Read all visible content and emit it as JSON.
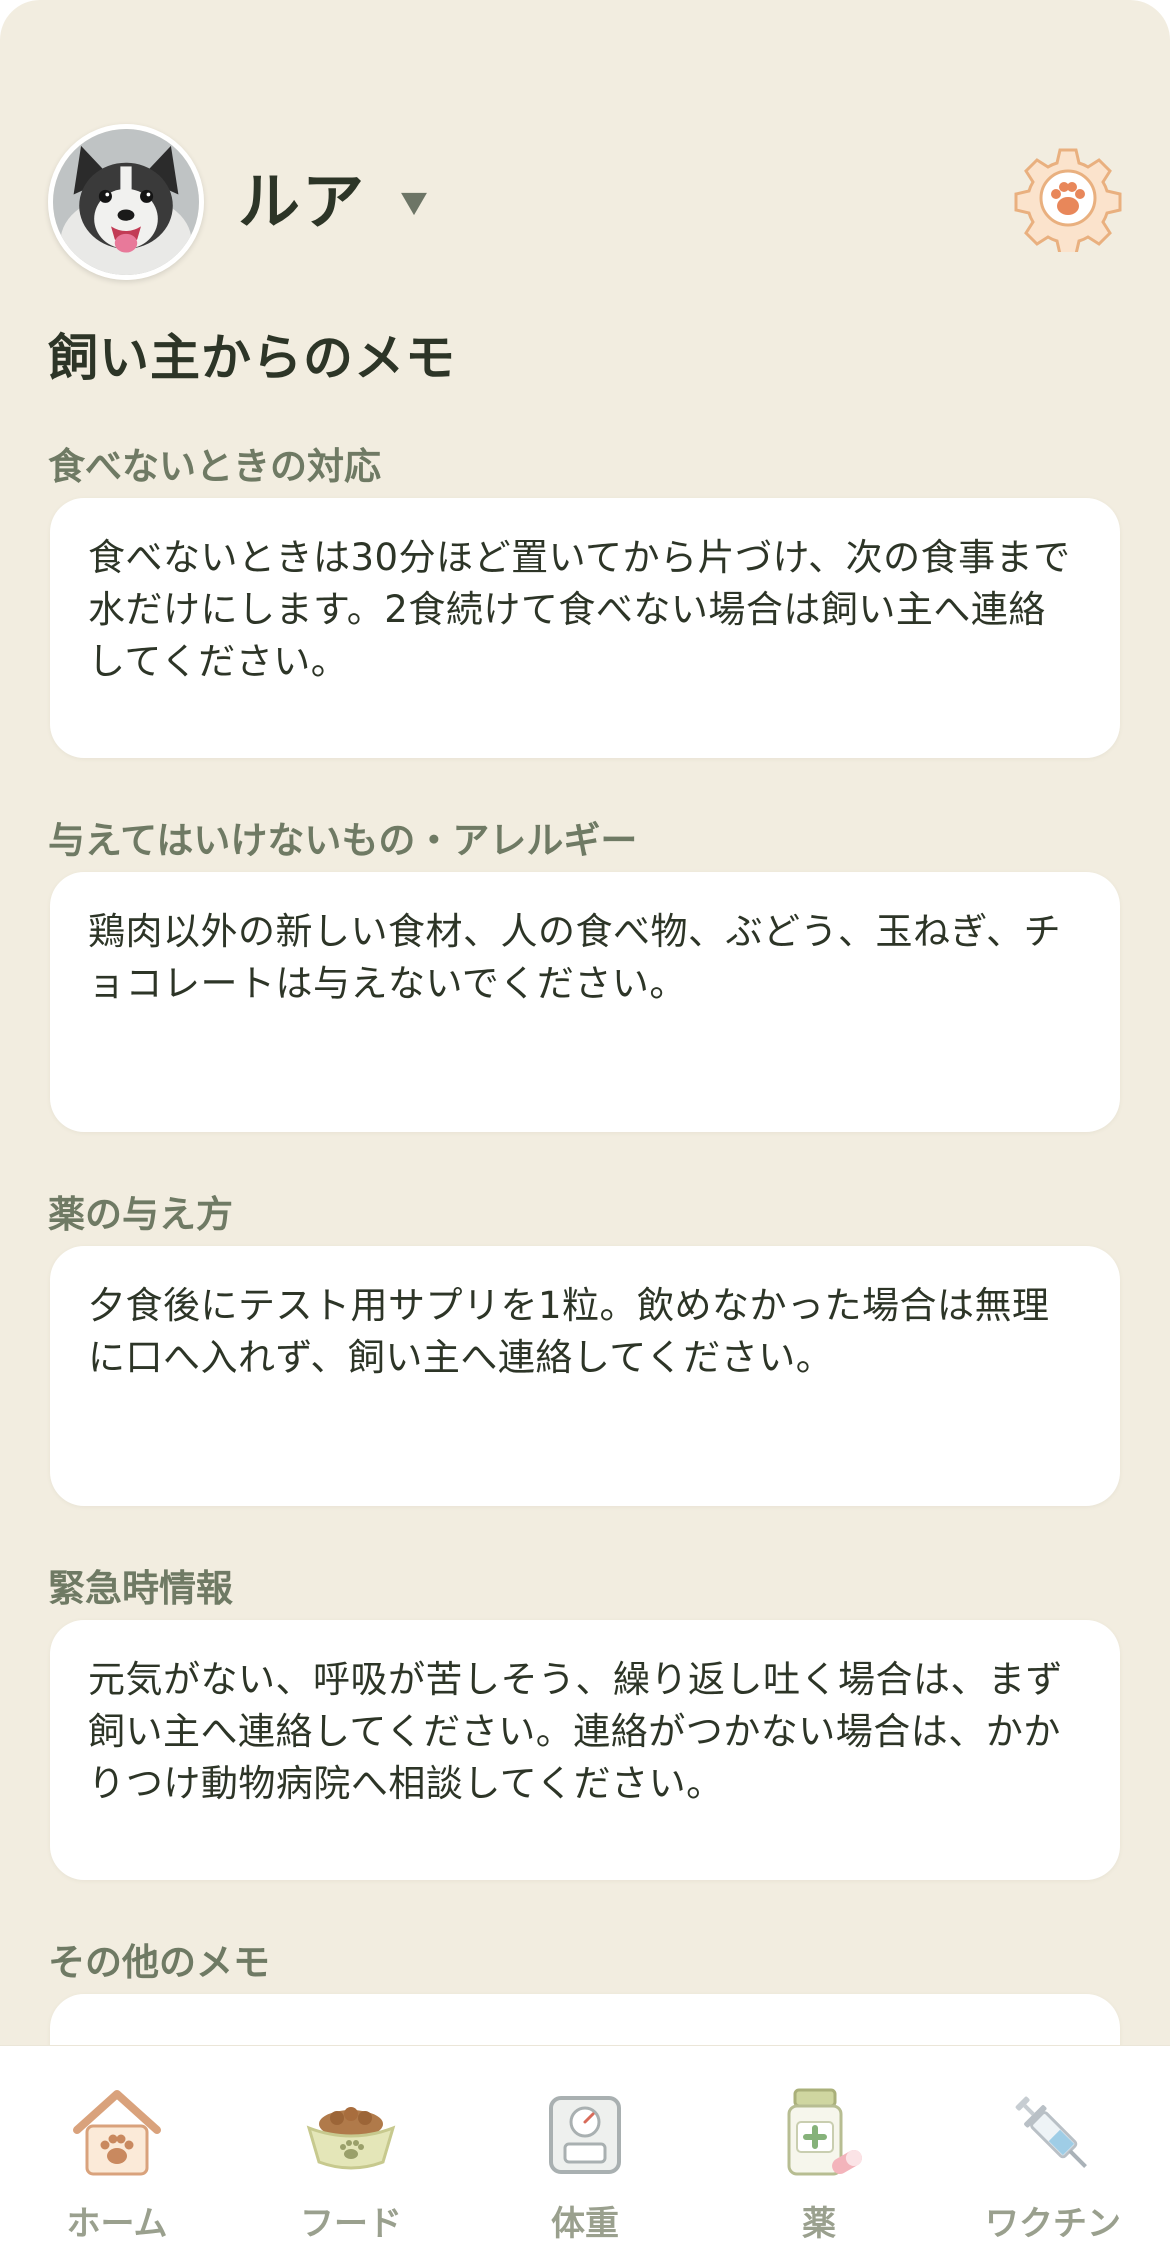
{
  "pet": {
    "name": "ルア",
    "dropdown_icon": "triangle-down-icon"
  },
  "header": {
    "settings_icon": "paw-gear-icon"
  },
  "page": {
    "title": "飼い主からのメモ"
  },
  "sections": [
    {
      "label": "食べないときの対応",
      "text": "食べないときは30分ほど置いてから片づけ、次の食事まで水だけにします。2食続けて食べない場合は飼い主へ連絡してください。"
    },
    {
      "label": "与えてはいけないもの・アレルギー",
      "text": "鶏肉以外の新しい食材、人の食べ物、ぶどう、玉ねぎ、チョコレートは与えないでください。"
    },
    {
      "label": "薬の与え方",
      "text": "夕食後にテスト用サプリを1粒。飲めなかった場合は無理に口へ入れず、飼い主へ連絡してください。"
    },
    {
      "label": "緊急時情報",
      "text": "元気がない、呼吸が苦しそう、繰り返し吐く場合は、まず飼い主へ連絡してください。連絡がつかない場合は、かかりつけ動物病院へ相談してください。"
    },
    {
      "label": "その他のメモ",
      "text": ""
    }
  ],
  "nav": [
    {
      "label": "ホーム",
      "icon": "house-paw-icon"
    },
    {
      "label": "フード",
      "icon": "food-bowl-icon"
    },
    {
      "label": "体重",
      "icon": "scale-icon"
    },
    {
      "label": "薬",
      "icon": "medicine-bottle-icon"
    },
    {
      "label": "ワクチン",
      "icon": "syringe-icon"
    }
  ],
  "colors": {
    "background": "#f2ede0",
    "card": "#ffffff",
    "text_dark": "#2d3527",
    "label_muted": "#6f7a64",
    "nav_label": "#9aa08e",
    "accent_orange": "#f0b07a"
  }
}
